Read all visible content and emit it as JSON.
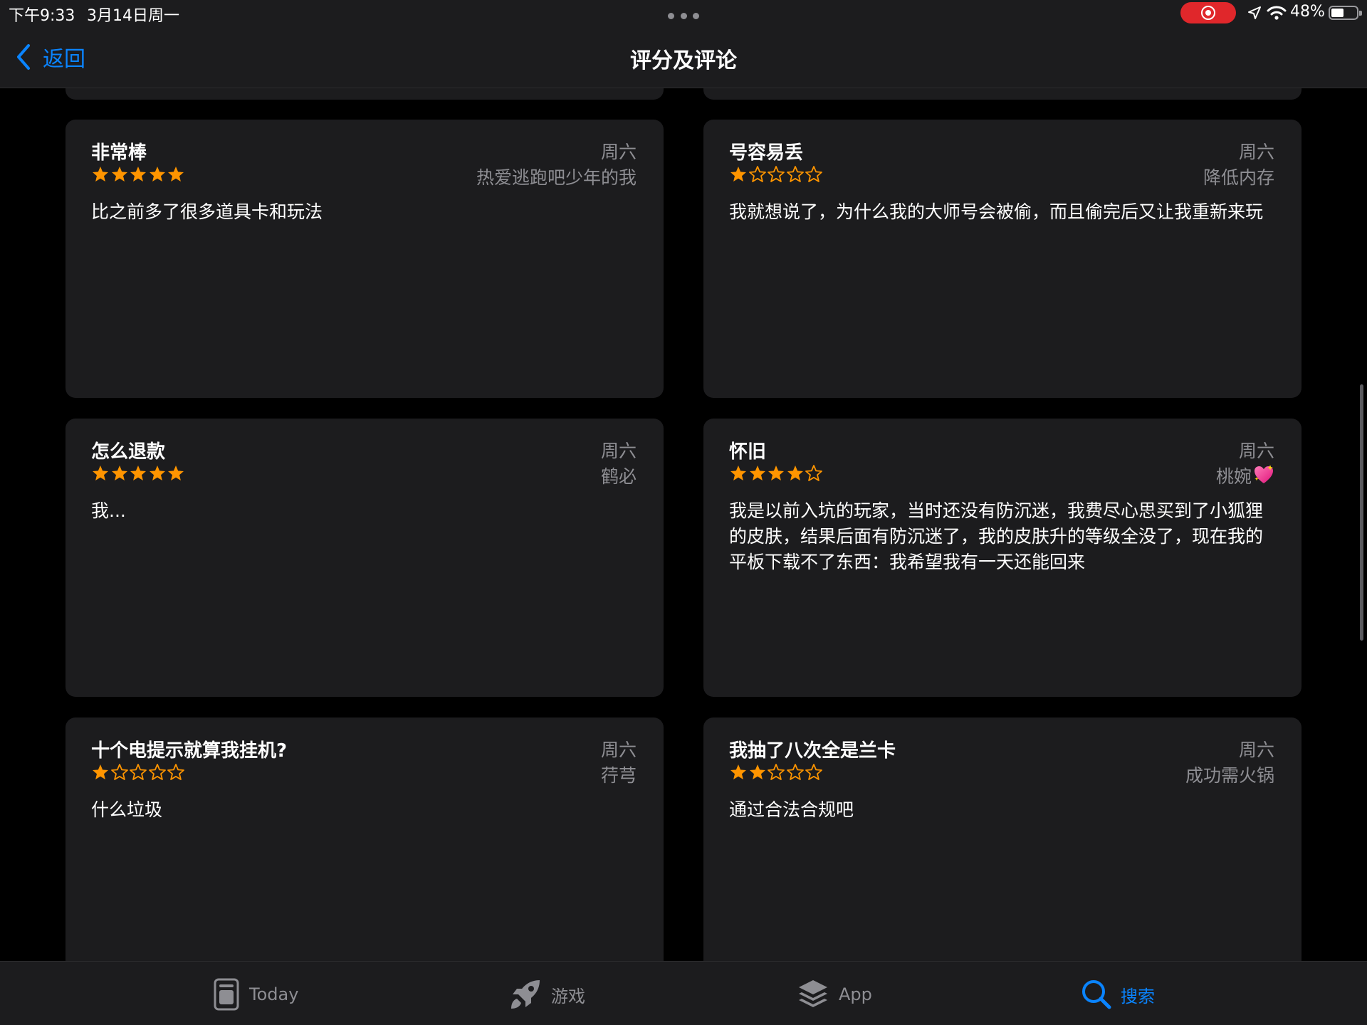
{
  "status_bar": {
    "time": "下午9:33",
    "date": "3月14日周一",
    "battery_percent": "48%",
    "battery_level": 0.48,
    "record_color": "#e0272b"
  },
  "nav": {
    "back_label": "返回",
    "title": "评分及评论",
    "accent_color": "#0a84ff"
  },
  "reviews": [
    {
      "title": "非常棒",
      "date": "周六",
      "author": "热爱逃跑吧少年的我",
      "rating": 5,
      "body": "比之前多了很多道具卡和玩法"
    },
    {
      "title": "号容易丢",
      "date": "周六",
      "author": "降低内存",
      "rating": 1,
      "body": "我就想说了，为什么我的大师号会被偷，而且偷完后又让我重新来玩"
    },
    {
      "title": "怎么退款",
      "date": "周六",
      "author": "鹤必",
      "rating": 5,
      "body": "我..."
    },
    {
      "title": "怀旧",
      "date": "周六",
      "author": "桃婉",
      "author_emoji": "sparkling-heart-icon",
      "rating": 4,
      "body": "我是以前入坑的玩家，当时还没有防沉迷，我费尽心思买到了小狐狸的皮肤，结果后面有防沉迷了，我的皮肤升的等级全没了，现在我的平板下载不了东西：我希望我有一天还能回来"
    },
    {
      "title": "十个电提示就算我挂机?",
      "date": "周六",
      "author": "荇芎",
      "rating": 1,
      "body": "什么垃圾"
    },
    {
      "title": "我抽了八次全是兰卡",
      "date": "周六",
      "author": "成功需火锅",
      "rating": 2,
      "body": "通过合法合规吧"
    }
  ],
  "star_color": "#ff9500",
  "tabs": [
    {
      "label": "Today",
      "icon": "today-icon",
      "active": false
    },
    {
      "label": "游戏",
      "icon": "rocket-icon",
      "active": false
    },
    {
      "label": "App",
      "icon": "app-stack-icon",
      "active": false
    },
    {
      "label": "搜索",
      "icon": "search-icon",
      "active": true
    }
  ]
}
